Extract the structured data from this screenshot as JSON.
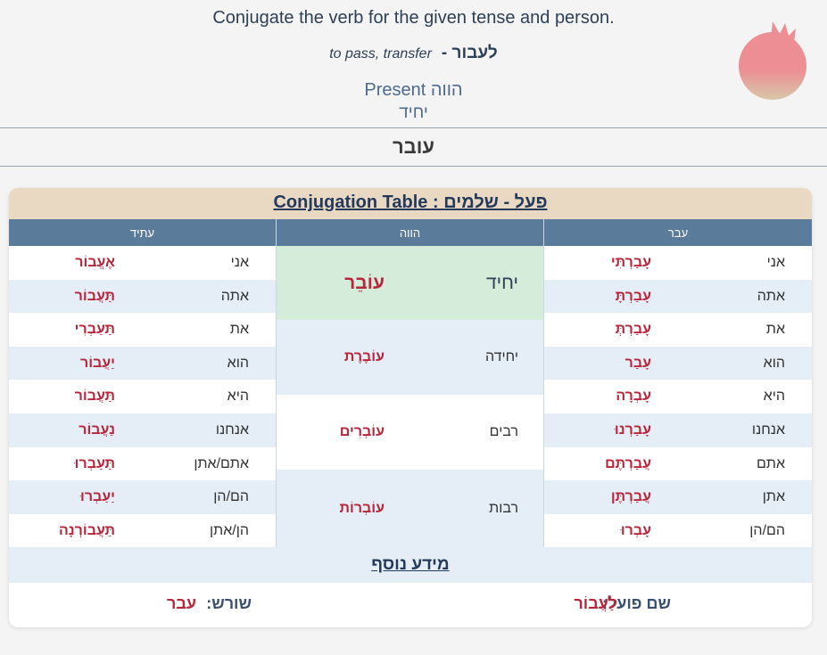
{
  "header": {
    "instruction": "Conjugate the verb for the given tense and person.",
    "translation": "to pass, transfer",
    "verb_heb": "לעבור -",
    "tense": "Present הווה",
    "person": "יחיד",
    "answer": "עובר"
  },
  "logo": {
    "icon": "pomegranate-icon",
    "color": "#ec8e93"
  },
  "table": {
    "title": "Conjugation Table : פעל - שלמים",
    "col_future": "עתיד",
    "col_present": "הווה",
    "col_past": "עבר",
    "future": [
      {
        "pron": "אני",
        "form": "אֶעֱבוֹר"
      },
      {
        "pron": "אתה",
        "form": "תַּעֲבוֹר"
      },
      {
        "pron": "את",
        "form": "תַּעַבְרִי"
      },
      {
        "pron": "הוא",
        "form": "יַעֲבוֹר"
      },
      {
        "pron": "היא",
        "form": "תַּעֲבוֹר"
      },
      {
        "pron": "אנחנו",
        "form": "נַעֲבוֹר"
      },
      {
        "pron": "אתם/אתן",
        "form": "תַּעַבְרוּ"
      },
      {
        "pron": "הם/הן",
        "form": "יַעַבְרוּ"
      },
      {
        "pron": "הן/אתן",
        "form": "תַּעֲבוֹרְנָה"
      }
    ],
    "present": [
      {
        "num": "יחיד",
        "form": "עוֹבֵר"
      },
      {
        "num": "יחידה",
        "form": "עוֹבֶרֶת"
      },
      {
        "num": "רבים",
        "form": "עוֹבְרִים"
      },
      {
        "num": "רבות",
        "form": "עוֹבְרוֹת"
      }
    ],
    "past": [
      {
        "pron": "אני",
        "form": "עָבַרְתִּי"
      },
      {
        "pron": "אתה",
        "form": "עָבַרְתָּ"
      },
      {
        "pron": "את",
        "form": "עָבַרְתְּ"
      },
      {
        "pron": "הוא",
        "form": "עָבַר"
      },
      {
        "pron": "היא",
        "form": "עָבְרָה"
      },
      {
        "pron": "אנחנו",
        "form": "עָבַרְנוּ"
      },
      {
        "pron": "אתם",
        "form": "עֲבַרְתֶּם"
      },
      {
        "pron": "אתן",
        "form": "עֲבַרְתֶּן"
      },
      {
        "pron": "הם/הן",
        "form": "עָבְרוּ"
      }
    ]
  },
  "more_info": {
    "title": "מידע נוסף",
    "infinitive_label": "שם פועל:",
    "infinitive_value": "לַעֲבוֹר",
    "root_label": "שורש:",
    "root_value": "עבר"
  }
}
